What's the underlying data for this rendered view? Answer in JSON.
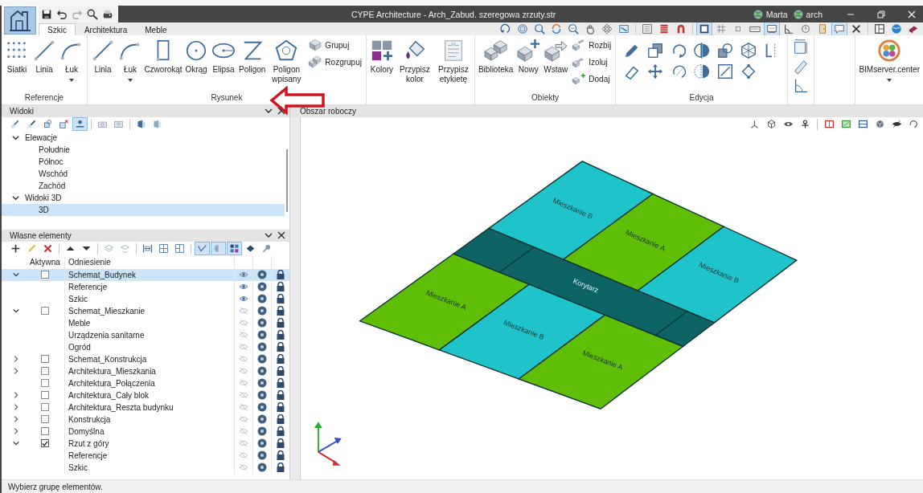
{
  "window": {
    "title": "CYPE Architecture - Arch_Zabud. szeregowa zrzuty.str",
    "users": [
      {
        "name": "Marta"
      },
      {
        "name": "arch"
      }
    ]
  },
  "tabs": [
    {
      "label": "Szkic",
      "selected": true
    },
    {
      "label": "Architektura",
      "selected": false
    },
    {
      "label": "Meble",
      "selected": false
    }
  ],
  "top_toolbar": [
    {
      "on": false
    },
    {
      "on": false
    },
    {
      "on": false
    },
    {
      "on": false
    },
    {
      "on": false
    },
    {
      "on": false
    },
    {
      "on": false
    },
    {
      "on": false
    },
    {
      "on": false
    },
    {
      "on": false
    },
    {
      "on": false
    },
    {
      "on": true
    },
    {
      "on": false
    },
    {
      "on": false
    },
    {
      "on": false
    },
    {
      "on": true
    },
    {
      "on": false
    },
    {
      "on": false
    },
    {
      "on": false
    },
    {
      "on": true
    },
    {
      "on": false
    },
    {
      "on": false
    },
    {
      "on": false
    },
    {
      "on": false
    }
  ],
  "ribbon": {
    "groups": [
      {
        "kind": "tools",
        "label": "Referencje",
        "tools": [
          {
            "label": "Siatki",
            "kind": "large",
            "dropdown": false
          },
          {
            "label": "Linia",
            "kind": "large",
            "dropdown": false
          },
          {
            "label": "Łuk",
            "kind": "large",
            "dropdown": true
          }
        ]
      },
      {
        "kind": "tools",
        "label": "Rysunek",
        "tools": [
          {
            "label": "Linia",
            "kind": "large",
            "dropdown": false
          },
          {
            "label": "Łuk",
            "kind": "large",
            "dropdown": true
          },
          {
            "label": "Czworokąt",
            "kind": "large",
            "dropdown": false
          },
          {
            "label": "Okrąg",
            "kind": "large",
            "dropdown": false
          },
          {
            "label": "Elipsa",
            "kind": "large",
            "dropdown": false
          },
          {
            "label": "Poligon",
            "kind": "large",
            "dropdown": false
          },
          {
            "label": "Poligon wpisany",
            "kind": "large",
            "dropdown": false
          },
          {
            "label": "Grupuj",
            "kind": "small",
            "dropdown": false
          },
          {
            "label": "Rozgrupuj",
            "kind": "small",
            "dropdown": false
          }
        ]
      },
      {
        "kind": "tools",
        "tools": [
          {
            "label": "Kolory",
            "kind": "large",
            "dropdown": false
          },
          {
            "label": "Przypisz kolor",
            "kind": "large",
            "dropdown": false
          },
          {
            "label": "Przypisz etykietę",
            "kind": "large",
            "dropdown": false
          }
        ]
      },
      {
        "kind": "tools",
        "label": "Obiekty",
        "tools": [
          {
            "label": "Biblioteka",
            "kind": "large",
            "dropdown": false
          },
          {
            "label": "Nowy",
            "kind": "large",
            "dropdown": false
          },
          {
            "label": "Wstaw",
            "kind": "large",
            "dropdown": false
          },
          {
            "label": "Rozbij",
            "kind": "small",
            "dropdown": false
          },
          {
            "label": "Izoluj",
            "kind": "small",
            "dropdown": false
          },
          {
            "label": "Dodaj",
            "kind": "small",
            "dropdown": false
          }
        ]
      },
      {
        "kind": "icons",
        "label": "Edycja"
      },
      {
        "kind": "icons"
      },
      {
        "kind": "tools",
        "tools": [
          {
            "label": "BIMserver.center",
            "kind": "large",
            "dropdown": true
          }
        ]
      }
    ]
  },
  "views_panel": {
    "title": "Widoki",
    "toolbar": [
      {
        "on": false
      },
      {
        "on": false
      },
      {
        "on": false
      },
      {
        "on": false
      },
      {
        "on": true
      },
      {
        "on": false
      },
      {
        "on": false
      },
      {
        "on": false
      },
      {
        "on": false
      }
    ],
    "tree": [
      {
        "label": "Elewacje",
        "expanded": true,
        "children": [
          {
            "label": "Południe",
            "selected": false
          },
          {
            "label": "Północ",
            "selected": false
          },
          {
            "label": "Wschód",
            "selected": false
          },
          {
            "label": "Zachód",
            "selected": false
          }
        ]
      },
      {
        "label": "Widoki 3D",
        "expanded": true,
        "children": [
          {
            "label": "3D",
            "selected": true
          }
        ]
      }
    ]
  },
  "elements_panel": {
    "title": "Własne elementy",
    "toolbar": [
      {
        "on": false
      },
      {
        "on": false
      },
      {
        "on": false
      },
      {
        "on": false
      },
      {
        "on": false
      },
      {
        "on": false
      },
      {
        "on": false
      },
      {
        "on": false
      },
      {
        "on": false
      },
      {
        "on": false
      },
      {
        "on": true
      },
      {
        "on": true
      },
      {
        "on": true
      },
      {
        "on": false
      },
      {
        "on": false
      }
    ],
    "columns": [
      "Aktywna",
      "Odniesienie"
    ],
    "rows": [
      {
        "name": "Schemat_Budynek",
        "expandable": true,
        "expanded": true,
        "active": false,
        "visible": true,
        "selected": true,
        "children": [
          {
            "name": "Referencje",
            "visible": true,
            "selected": false
          },
          {
            "name": "Szkic",
            "visible": true,
            "selected": false
          }
        ]
      },
      {
        "name": "Schemat_Mieszkanie",
        "expandable": true,
        "expanded": true,
        "active": false,
        "visible": false,
        "selected": false,
        "children": [
          {
            "name": "Meble",
            "visible": false,
            "selected": false
          },
          {
            "name": "Urządzenia sanitarne",
            "visible": false,
            "selected": false
          },
          {
            "name": "Ogród",
            "visible": false,
            "selected": false
          }
        ]
      },
      {
        "name": "Schemat_Konstrukcja",
        "expandable": true,
        "expanded": false,
        "active": false,
        "visible": false,
        "selected": false
      },
      {
        "name": "Architektura_Mieszkania",
        "expandable": true,
        "expanded": false,
        "active": false,
        "visible": false,
        "selected": false
      },
      {
        "name": "Architektura_Połączenia",
        "expandable": false,
        "active": false,
        "visible": false,
        "selected": false
      },
      {
        "name": "Architektura_Cały blok",
        "expandable": true,
        "expanded": false,
        "active": false,
        "visible": false,
        "selected": false
      },
      {
        "name": "Architektura_Reszta budynku",
        "expandable": true,
        "expanded": false,
        "active": false,
        "visible": false,
        "selected": false
      },
      {
        "name": "Konstrukcja",
        "expandable": true,
        "expanded": false,
        "active": false,
        "visible": false,
        "selected": false
      },
      {
        "name": "Domyślna",
        "expandable": true,
        "expanded": false,
        "active": false,
        "visible": false,
        "selected": false
      },
      {
        "name": "Rzut z góry",
        "expandable": true,
        "expanded": true,
        "active": true,
        "visible": false,
        "selected": false,
        "children": [
          {
            "name": "Referencje",
            "visible": false,
            "selected": false
          },
          {
            "name": "Szkic",
            "visible": false,
            "selected": false
          }
        ]
      }
    ]
  },
  "workspace": {
    "title": "Obszar roboczy",
    "plan": {
      "rooms": [
        {
          "label": "Mieszkanie B",
          "color": "#1ec4ca"
        },
        {
          "label": "Mieszkanie A",
          "color": "#5fbf06"
        },
        {
          "label": "Mieszkanie B",
          "color": "#1ec4ca"
        },
        {
          "label": "Korytarz",
          "color": "#0e6464"
        },
        {
          "label": "Mieszkanie A",
          "color": "#5fbf06"
        },
        {
          "label": "Mieszkanie B",
          "color": "#1ec4ca"
        },
        {
          "label": "Mieszkanie A",
          "color": "#5fbf06"
        }
      ]
    }
  },
  "status_bar": {
    "text": "Wybierz grupę elementów."
  }
}
